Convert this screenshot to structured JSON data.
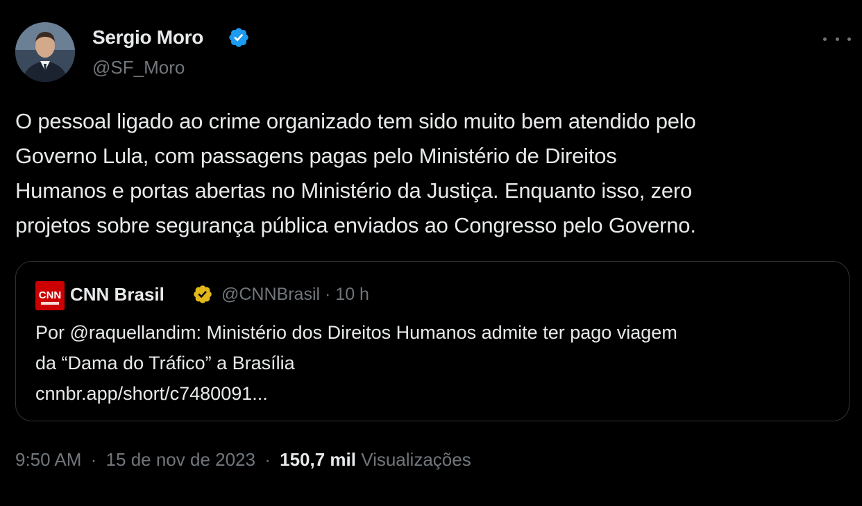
{
  "author": {
    "name": "Sergio Moro",
    "handle": "@SF_Moro",
    "verified": true,
    "verified_color": "#1d9bf0"
  },
  "tweet": {
    "text_lines": [
      "O pessoal ligado ao crime organizado tem sido muito bem atendido pelo",
      "Governo Lula, com passagens pagas pelo Ministério de Direitos",
      "Humanos e portas abertas no Ministério da Justiça. Enquanto isso, zero",
      "projetos sobre segurança pública enviados ao Congresso pelo Governo."
    ]
  },
  "quote": {
    "logo_text": "CNN",
    "name": "CNN Brasil",
    "verified_color": "#e2b719",
    "handle": "@CNNBrasil",
    "separator": "·",
    "time": "10 h",
    "text_lines": [
      "Por @raquellandim: Ministério dos Direitos Humanos admite ter pago viagem",
      "da “Dama do Tráfico” a Brasília",
      "cnnbr.app/short/c7480091..."
    ]
  },
  "footer": {
    "time": "9:50 AM",
    "separator": "·",
    "date": "15 de nov de 2023",
    "views_count": "150,7 mil",
    "views_label": "Visualizações"
  },
  "colors": {
    "background": "#000000",
    "text_primary": "#e7e9ea",
    "text_secondary": "#71767b",
    "border": "#2f3336",
    "cnn_red": "#cc0000"
  },
  "icons": {
    "more": "more-horizontal-icon",
    "verified_author": "verified-badge-icon",
    "verified_quote": "verified-gold-badge-icon"
  }
}
